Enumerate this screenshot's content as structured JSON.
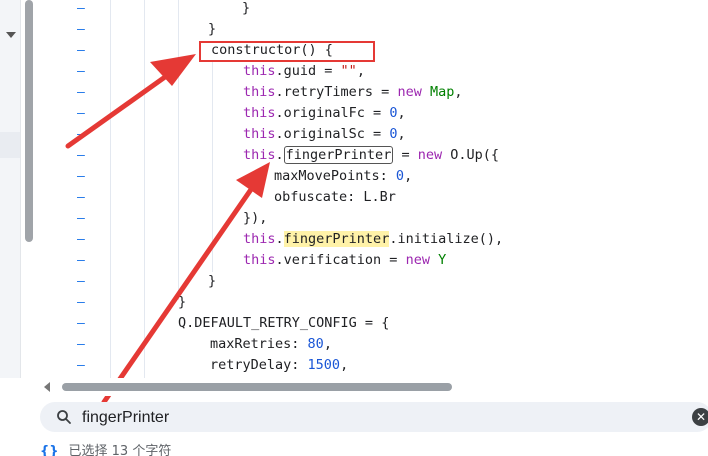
{
  "code": {
    "line_marker": "–",
    "l0_brace": "}",
    "l1_brace": "}",
    "constructor_sig": "constructor() {",
    "this_kw": "this",
    "guid_rest": ".guid = ",
    "guid_val": "\"\"",
    "retry_rest": ".retryTimers = ",
    "new_kw": "new",
    "map_cls": " Map",
    "fc_rest": ".originalFc = ",
    "sc_rest": ".originalSc = ",
    "zero": "0",
    "comma": ",",
    "fp_prop": "fingerPrinter",
    "fp_assign": " = ",
    "fp_ctor": " O.Up({",
    "maxmove_key": "maxMovePoints: ",
    "obf_key": "obfuscate: ",
    "obf_val": "L.Br",
    "close_paren": "}),",
    "init_rest": ".initialize(),",
    "verif_rest": ".verification = ",
    "y_cls": " Y",
    "method_close": "}",
    "class_close": "}",
    "config_line": "Q.DEFAULT_RETRY_CONFIG = {",
    "maxretries_key": "maxRetries: ",
    "maxretries_val": "80",
    "retrydelay_key": "retryDelay: ",
    "retrydelay_val": "1500"
  },
  "search": {
    "query": "fingerPrinter",
    "icon": "search-icon",
    "clear_icon": "clear-icon"
  },
  "status": {
    "braces": "{}",
    "text": "已选择 13 个字符"
  },
  "colors": {
    "annotation": "#e53935",
    "keyword": "#9c27b0",
    "number": "#1a56d6",
    "highlight": "#fff2a8"
  }
}
